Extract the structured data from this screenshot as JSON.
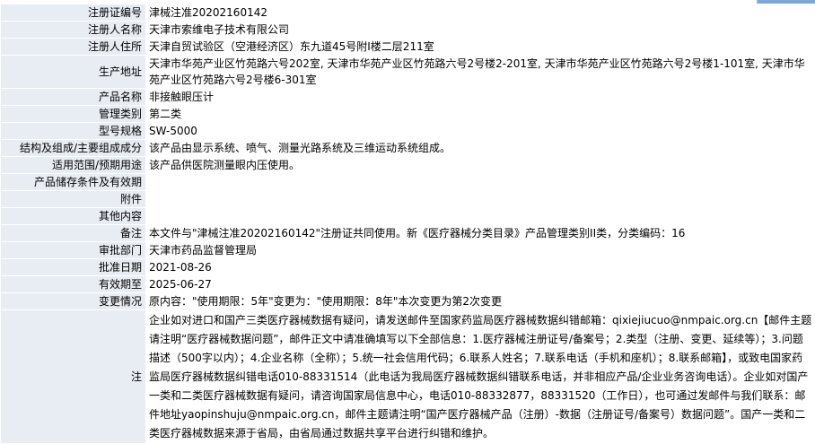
{
  "window": {
    "topbar_accent": "#7da6d6"
  },
  "colors": {
    "label_bg": "#e8edf4",
    "value_bg": "#ffffff",
    "border": "#ffffff"
  },
  "rows": [
    {
      "label": "注册证编号",
      "value": "津械注准20202160142"
    },
    {
      "label": "注册人名称",
      "value": "天津市索维电子技术有限公司"
    },
    {
      "label": "注册人住所",
      "value": "天津自贸试验区（空港经济区）东九道45号附I楼二层211室"
    },
    {
      "label": "生产地址",
      "value": "天津市华苑产业区竹苑路六号202室, 天津市华苑产业区竹苑路六号2号楼2-201室, 天津市华苑产业区竹苑路六号2号楼1-101室, 天津市华苑产业区竹苑路六号2号楼6-301室"
    },
    {
      "label": "产品名称",
      "value": "非接触眼压计"
    },
    {
      "label": "管理类别",
      "value": "第二类"
    },
    {
      "label": "型号规格",
      "value": "SW-5000"
    },
    {
      "label": "结构及组成/主要组成成分",
      "value": "该产品由显示系统、喷气、测量光路系统及三维运动系统组成。"
    },
    {
      "label": "适用范围/预期用途",
      "value": "该产品供医院测量眼内压使用。"
    },
    {
      "label": "产品储存条件及有效期",
      "value": ""
    },
    {
      "label": "附件",
      "value": ""
    },
    {
      "label": "其他内容",
      "value": ""
    },
    {
      "label": "备注",
      "value": "本文件与\"津械注准20202160142\"注册证共同使用。新《医疗器械分类目录》产品管理类别II类，分类编码：16"
    },
    {
      "label": "审批部门",
      "value": "天津市药品监督管理局"
    },
    {
      "label": "批准日期",
      "value": "2021-08-26"
    },
    {
      "label": "有效期至",
      "value": "2025-06-27"
    },
    {
      "label": "变更情况",
      "value": "原内容：\"使用期限：5年\"变更为：\"使用期限：8年\"本次变更为第2次变更"
    }
  ],
  "note": {
    "label": "注",
    "text": "企业如对进口和国产三类医疗器械数据有疑问，请发送邮件至国家药监局医疗器械数据纠错邮箱：qixiejiucuo@nmpaic.org.cn【邮件主题请注明“医疗器械数据问题”，邮件正文中请准确填写以下全部信息：1.医疗器械注册证号/备案号；2.类型（注册、变更、延续等）；3.问题描述（500字以内）；4.企业名称（全称）；5.统一社会信用代码；6.联系人姓名；7.联系电话（手机和座机）；8.联系邮箱】，或致电国家药监局医疗器械数据纠错电话010-88331514（此电话为我局医疗器械数据纠错联系电话，并非相应产品/企业业务咨询电话）。企业如对国产一类和二类医疗器械数据有疑问，请咨询国家局信息中心，电话010-88332877，88331520（工作日），也可通过发邮件与我们联系：邮件地址yaopinshuju@nmpaic.org.cn，邮件主题请注明“国产医疗器械产品（注册）-数据（注册证号/备案号）数据问题”。国产一类和二类医疗器械数据来源于省局，由省局通过数据共享平台进行纠错和维护。"
  }
}
